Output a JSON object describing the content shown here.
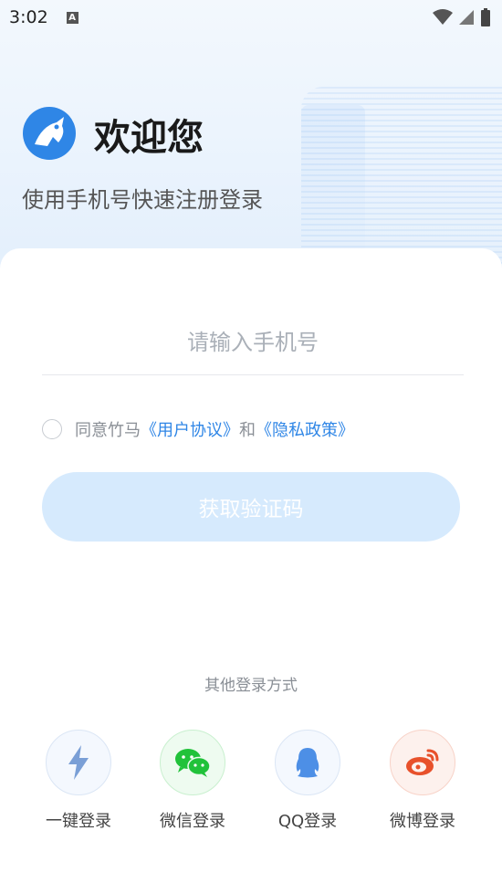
{
  "status_bar": {
    "time": "3:02",
    "badge": "A"
  },
  "header": {
    "title": "欢迎您",
    "subtitle": "使用手机号快速注册登录"
  },
  "form": {
    "phone_placeholder": "请输入手机号",
    "agreement": {
      "prefix": "同意竹马",
      "user_agreement": "《用户协议》",
      "and": "和",
      "privacy_policy": "《隐私政策》"
    },
    "get_code_label": "获取验证码"
  },
  "other_login": {
    "title": "其他登录方式",
    "options": [
      {
        "label": "一键登录",
        "icon": "lightning-icon"
      },
      {
        "label": "微信登录",
        "icon": "wechat-icon"
      },
      {
        "label": "QQ登录",
        "icon": "qq-icon"
      },
      {
        "label": "微博登录",
        "icon": "weibo-icon"
      }
    ]
  },
  "colors": {
    "accent": "#2f86e6",
    "button_disabled": "#d6eafd",
    "wechat_green": "#21c23a",
    "weibo_red": "#e8512b",
    "qq_blue": "#4d8fe6"
  }
}
